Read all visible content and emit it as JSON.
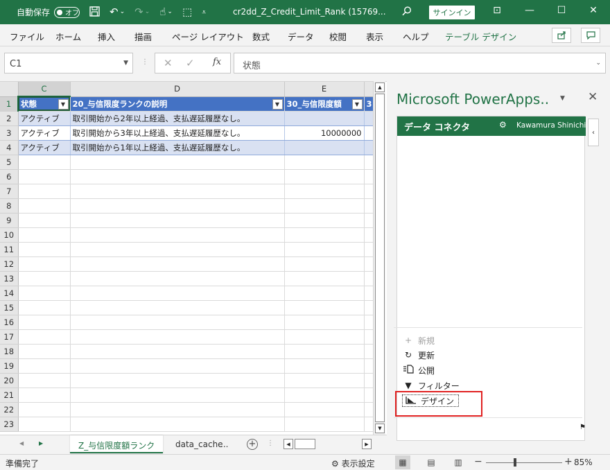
{
  "titlebar": {
    "autosave_label": "自動保存",
    "autosave_state": "オフ",
    "filename": "cr2dd_Z_Credit_Limit_Rank (15769...",
    "signin": "サインイン"
  },
  "ribbon": {
    "tabs": [
      "ファイル",
      "ホーム",
      "挿入",
      "描画",
      "ページ レイアウト",
      "数式",
      "データ",
      "校閲",
      "表示",
      "ヘルプ",
      "テーブル デザイン"
    ]
  },
  "formula_bar": {
    "name_box": "C1",
    "fx": "fx",
    "value": "状態"
  },
  "grid": {
    "columns": [
      "C",
      "D",
      "E"
    ],
    "headers": [
      "状態",
      "20_与信限度ランクの説明",
      "30_与信限度額",
      "3"
    ],
    "rows": [
      {
        "num": "2",
        "cells": [
          "アクティブ",
          "取引開始から2年以上経過、支払遅延履歴なし。",
          ""
        ]
      },
      {
        "num": "3",
        "cells": [
          "アクティブ",
          "取引開始から3年以上経過、支払遅延履歴なし。",
          "10000000"
        ]
      },
      {
        "num": "4",
        "cells": [
          "アクティブ",
          "取引開始から1年以上経過、支払遅延履歴なし。",
          ""
        ]
      }
    ],
    "empty_rows": [
      "5",
      "6",
      "7",
      "8",
      "9",
      "10",
      "11",
      "12",
      "13",
      "14",
      "15",
      "16",
      "17",
      "18",
      "19",
      "20",
      "21",
      "22",
      "23"
    ]
  },
  "sheet_tabs": {
    "active": "Z_与信限度額ランク",
    "other": "data_cache",
    "more": "..."
  },
  "pane": {
    "title": "Microsoft PowerApps..",
    "header": "データ コネクタ",
    "user": "Kawamura Shinichi",
    "actions": [
      {
        "label": "新規",
        "icon": "plus-icon"
      },
      {
        "label": "更新",
        "icon": "refresh-icon"
      },
      {
        "label": "公開",
        "icon": "publish-icon"
      },
      {
        "label": "フィルター",
        "icon": "filter-icon"
      },
      {
        "label": "デザイン",
        "icon": "design-icon"
      }
    ]
  },
  "statusbar": {
    "ready": "準備完了",
    "display_settings": "表示設定",
    "zoom": "85%"
  },
  "colors": {
    "excel_green": "#217346",
    "table_header": "#4472c4",
    "table_band": "#d9e1f2",
    "highlight": "#e02020"
  }
}
